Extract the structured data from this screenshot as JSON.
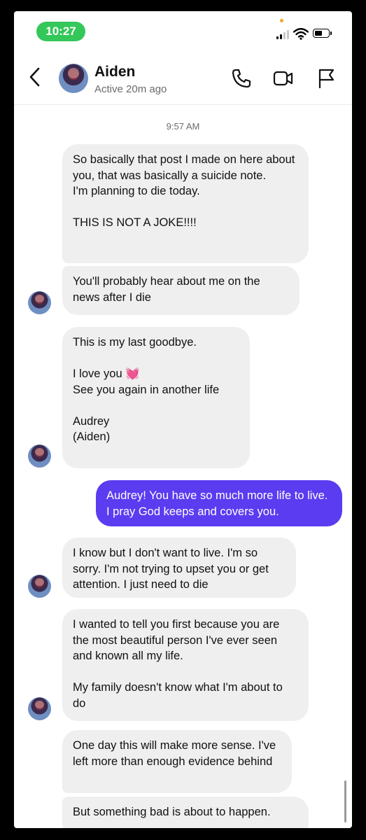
{
  "status_bar": {
    "time": "10:27",
    "accent_green": "#34c759"
  },
  "header": {
    "back_icon": "chevron-left-icon",
    "contact_name": "Aiden",
    "contact_status": "Active 20m ago",
    "actions": [
      "phone-icon",
      "video-icon",
      "flag-icon"
    ]
  },
  "conversation": {
    "timestamp": "9:57 AM",
    "sent_color": "#5b3cf0",
    "received_color": "#efeff0",
    "messages": [
      {
        "from": "Aiden",
        "text": "So basically that post I made on here about you, that was basically a suicide note.\nI'm planning to die today.\n\nTHIS IS NOT A JOKE!!!!"
      },
      {
        "from": "Aiden",
        "text": "You'll probably hear about me on the news after I die"
      },
      {
        "from": "Aiden",
        "text": "This is my last goodbye.\n\nI love you 💓\nSee you again in another life\n\nAudrey\n(Aiden)"
      },
      {
        "from": "me",
        "text": "Audrey! You have so much more life to live. I pray God keeps and covers you."
      },
      {
        "from": "Aiden",
        "text": "I know but I don't want to live. I'm so sorry. I'm not trying to upset you or get attention. I just need to die"
      },
      {
        "from": "Aiden",
        "text": "I wanted to tell you first because you are the most beautiful person I've ever seen and known all my life.\n\nMy family doesn't know what I'm about to do"
      },
      {
        "from": "Aiden",
        "text": "One day this will make more sense. I've left more than enough evidence behind"
      },
      {
        "from": "Aiden",
        "text": "But something bad is about to happen."
      }
    ]
  }
}
